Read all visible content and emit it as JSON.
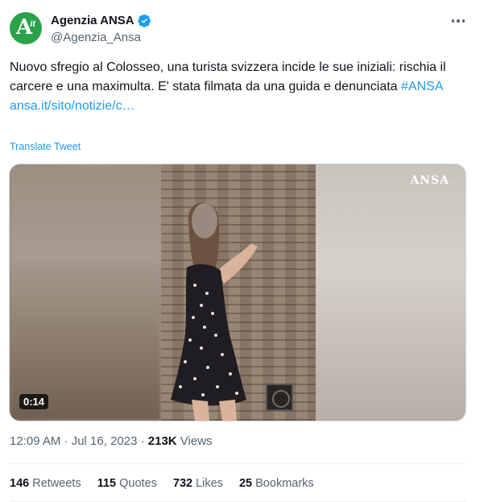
{
  "account": {
    "display_name": "Agenzia ANSA",
    "handle": "@Agenzia_Ansa",
    "avatar_text_main": "A",
    "avatar_text_sub": "it",
    "verified_icon": "verified-badge-icon",
    "brand_color": "#2aa24a"
  },
  "tweet": {
    "text": "Nuovo sfregio al Colosseo, una turista svizzera incide le sue iniziali: rischia il carcere e una maximulta. E' stata filmata da una guida e denunciata ",
    "hashtag": "#ANSA",
    "link": "ansa.it/sito/notizie/c…",
    "translate_label": "Translate Tweet"
  },
  "media": {
    "watermark": "ANSA",
    "duration": "0:14"
  },
  "meta": {
    "time": "12:09 AM · Jul 16, 2023 · ",
    "views_count": "213K",
    "views_label": " Views"
  },
  "stats": {
    "retweets_count": "146",
    "retweets_label": " Retweets",
    "quotes_count": "115",
    "quotes_label": " Quotes",
    "likes_count": "732",
    "likes_label": " Likes",
    "bookmarks_count": "25",
    "bookmarks_label": " Bookmarks"
  },
  "colors": {
    "link": "#1d9bf0",
    "secondary_text": "#536471"
  }
}
